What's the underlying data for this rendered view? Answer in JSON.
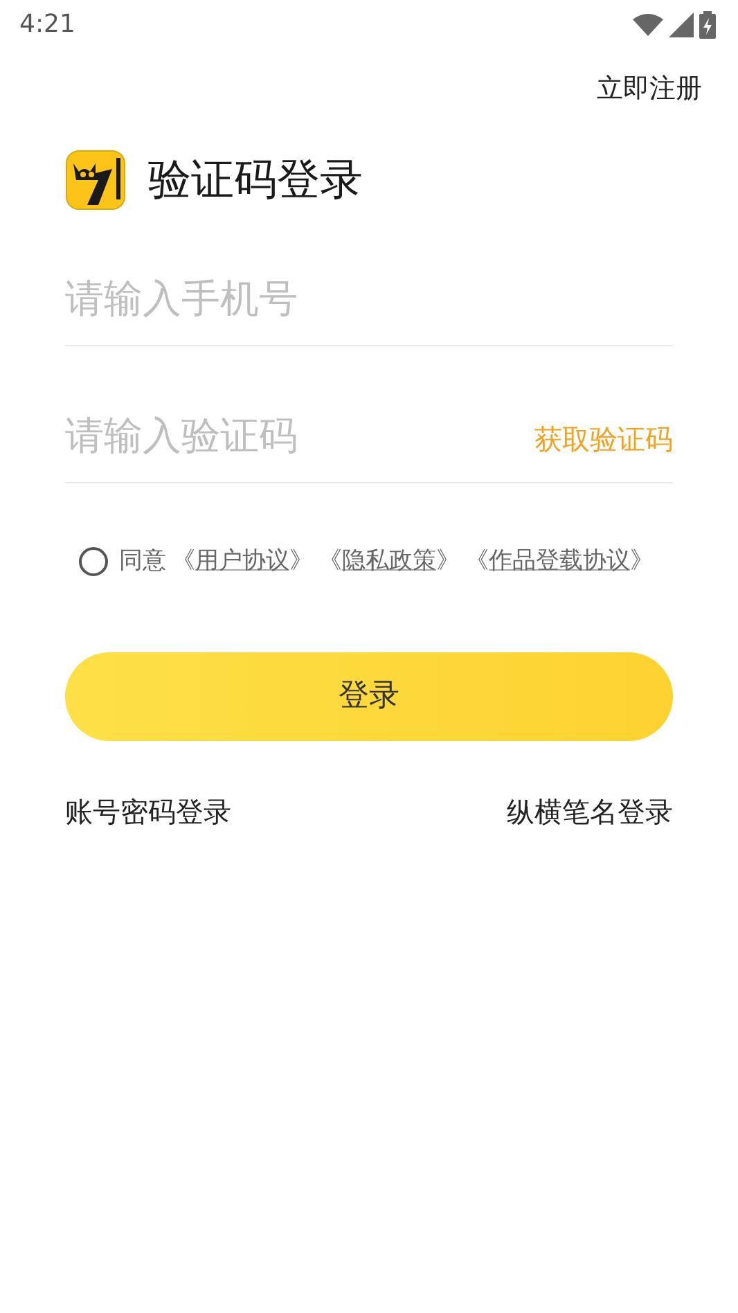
{
  "status_bar": {
    "time": "4:21"
  },
  "register_link": "立即注册",
  "header": {
    "title": "验证码登录"
  },
  "phone_field": {
    "placeholder": "请输入手机号"
  },
  "code_field": {
    "placeholder": "请输入验证码",
    "action": "获取验证码"
  },
  "agreement": {
    "checked": false,
    "text": "同意",
    "links": [
      {
        "open": "《",
        "label": "用户协议",
        "close": "》"
      },
      {
        "open": "《",
        "label": "隐私政策",
        "close": "》"
      },
      {
        "open": "《",
        "label": "作品登载协议",
        "close": "》"
      }
    ]
  },
  "login_button": "登录",
  "alt_logins": [
    "账号密码登录",
    "纵横笔名登录"
  ]
}
